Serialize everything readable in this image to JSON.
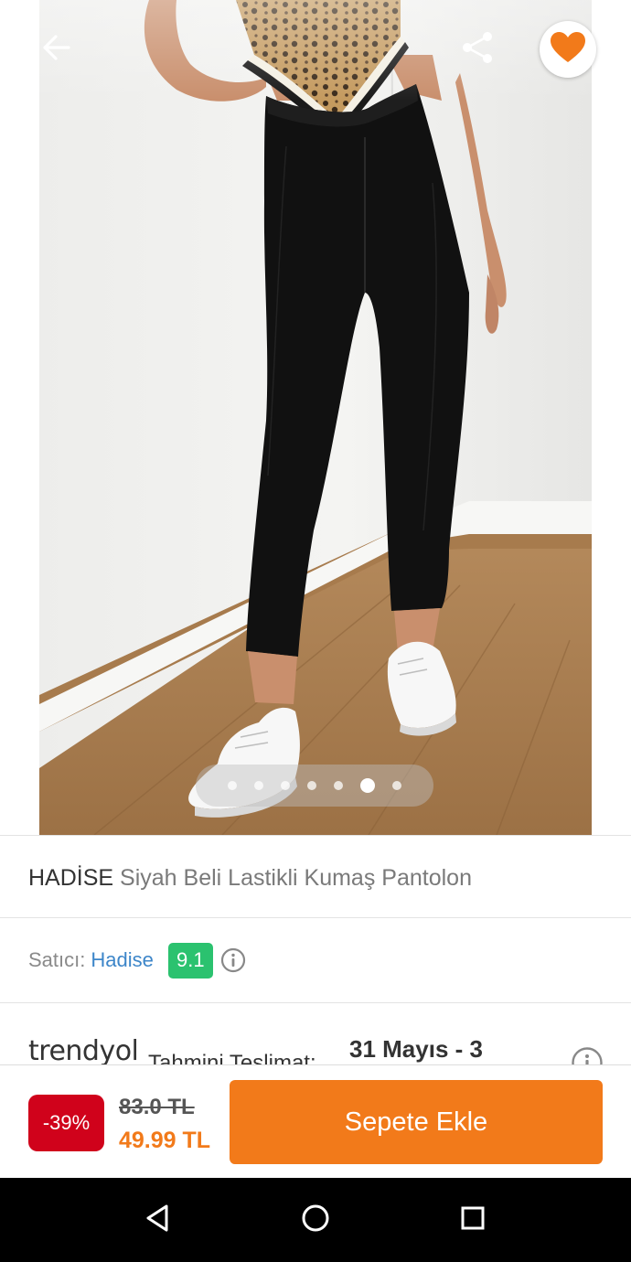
{
  "gallery": {
    "image_description_icon": "product-photo-black-trousers",
    "dot_count": 7,
    "active_dot_index": 5
  },
  "header": {
    "back_icon": "back-arrow-icon",
    "share_icon": "share-icon",
    "favorite_icon": "heart-icon",
    "favorite_color": "#f27a1a"
  },
  "product": {
    "brand": "HADİSE",
    "name": "Siyah Beli Lastikli Kumaş Pantolon"
  },
  "seller": {
    "label": "Satıcı:",
    "name": "Hadise",
    "rating": "9.1",
    "rating_color": "#2bc26f"
  },
  "delivery": {
    "logo": "trendyol",
    "label": "Tahmini Teslimat:",
    "date": "31 Mayıs - 3"
  },
  "pricing": {
    "discount": "-39%",
    "old_price": "83.0 TL",
    "new_price": "49.99 TL",
    "accent_color": "#f27a1a",
    "discount_color": "#d0021b"
  },
  "actions": {
    "add_to_cart": "Sepete Ekle"
  },
  "system_nav": {
    "back_icon": "nav-back-triangle-icon",
    "home_icon": "nav-home-circle-icon",
    "recents_icon": "nav-recents-square-icon"
  }
}
